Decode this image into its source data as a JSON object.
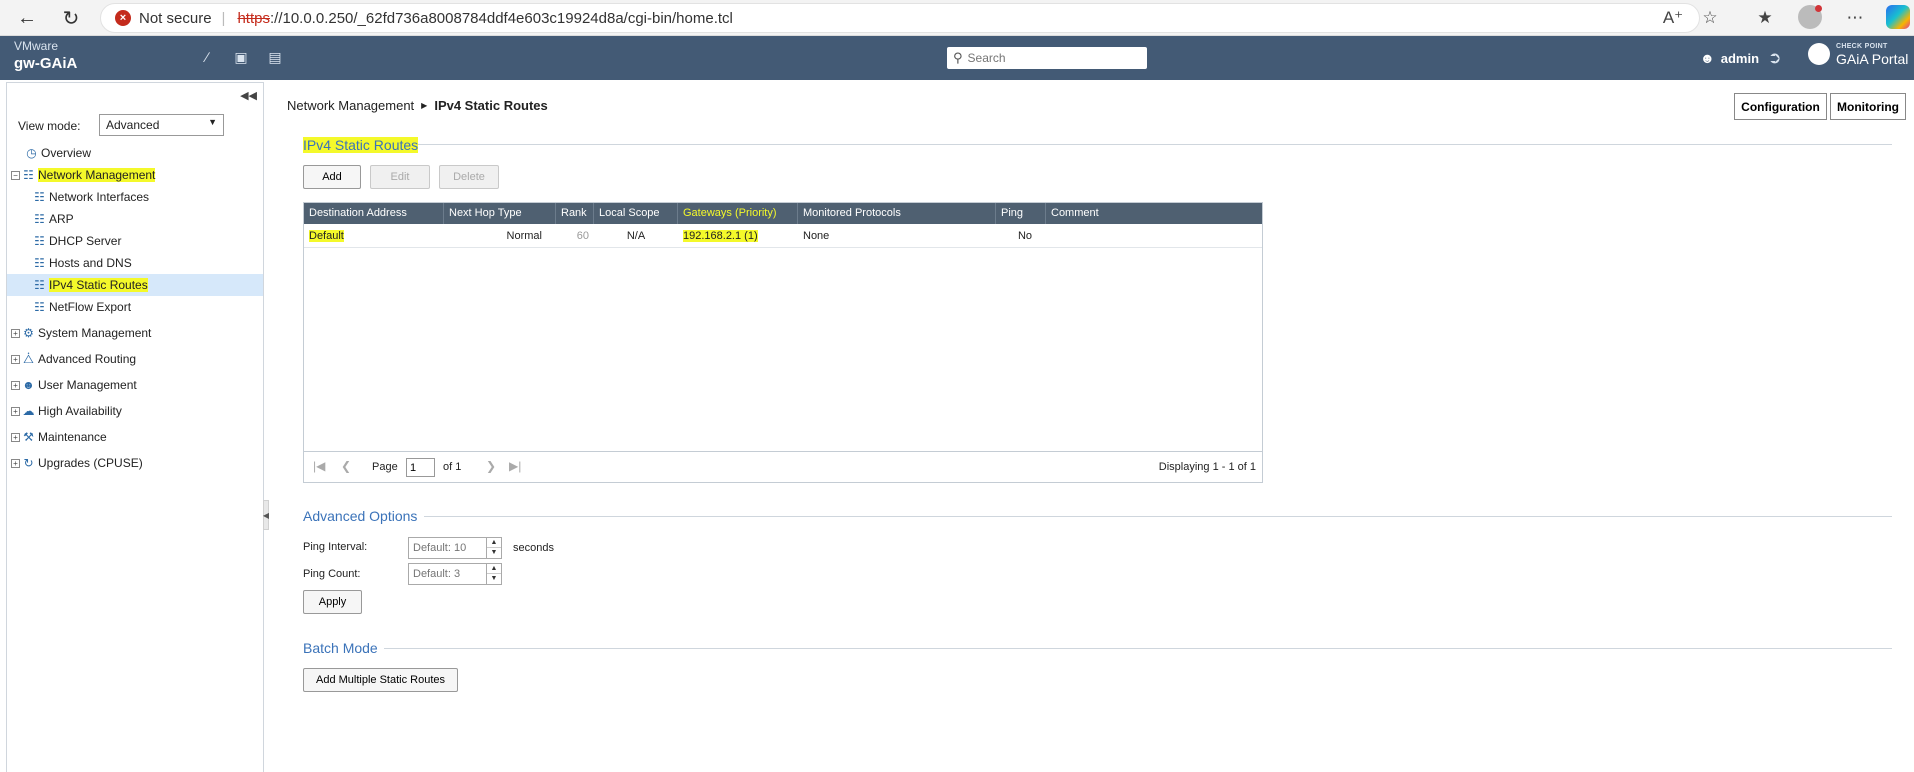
{
  "browser": {
    "not_secure": "Not secure",
    "separator": "|",
    "url_scheme": "https",
    "url_rest": "://10.0.0.250/_62fd736a8008784ddf4e603c19924d8a/cgi-bin/home.tcl"
  },
  "header": {
    "vendor": "VMware",
    "hostname": "gw-GAiA",
    "search_placeholder": "Search",
    "username": "admin",
    "logo_small": "CHECK POINT",
    "logo_portal": "GAiA Portal"
  },
  "sidebar": {
    "view_mode_label": "View mode:",
    "view_mode_value": "Advanced",
    "items": [
      {
        "label": "Overview"
      },
      {
        "label": "Network Management"
      },
      {
        "label": "Network Interfaces"
      },
      {
        "label": "ARP"
      },
      {
        "label": "DHCP Server"
      },
      {
        "label": "Hosts and DNS"
      },
      {
        "label": "IPv4 Static Routes"
      },
      {
        "label": "NetFlow Export"
      },
      {
        "label": "System Management"
      },
      {
        "label": "Advanced Routing"
      },
      {
        "label": "User Management"
      },
      {
        "label": "High Availability"
      },
      {
        "label": "Maintenance"
      },
      {
        "label": "Upgrades (CPUSE)"
      }
    ]
  },
  "breadcrumb": {
    "parent": "Network Management",
    "current": "IPv4 Static Routes"
  },
  "top_buttons": {
    "configuration": "Configuration",
    "monitoring": "Monitoring"
  },
  "routes": {
    "title": "IPv4 Static Routes",
    "buttons": {
      "add": "Add",
      "edit": "Edit",
      "delete": "Delete"
    },
    "columns": [
      "Destination Address",
      "Next Hop Type",
      "Rank",
      "Local Scope",
      "Gateways (Priority)",
      "Monitored Protocols",
      "Ping",
      "Comment"
    ],
    "rows": [
      {
        "destination": "Default",
        "next_hop_type": "Normal",
        "rank": "60",
        "local_scope": "N/A",
        "gateways": "192.168.2.1 (1)",
        "monitored_protocols": "None",
        "ping": "No",
        "comment": ""
      }
    ],
    "pager": {
      "page_label": "Page",
      "page_value": "1",
      "of_label": "of 1",
      "displaying": "Displaying 1 - 1 of 1"
    }
  },
  "advanced_options": {
    "title": "Advanced Options",
    "ping_interval_label": "Ping Interval:",
    "ping_interval_placeholder": "Default: 10",
    "ping_interval_unit": "seconds",
    "ping_count_label": "Ping Count:",
    "ping_count_placeholder": "Default: 3",
    "apply": "Apply"
  },
  "batch_mode": {
    "title": "Batch Mode",
    "add_multiple": "Add Multiple Static Routes"
  },
  "colors": {
    "header_bg": "#435a75",
    "grid_header_bg": "#4f6071",
    "section_title": "#3b73b9",
    "highlight": "#f4f92a",
    "selected_row": "#d6e8fa"
  }
}
